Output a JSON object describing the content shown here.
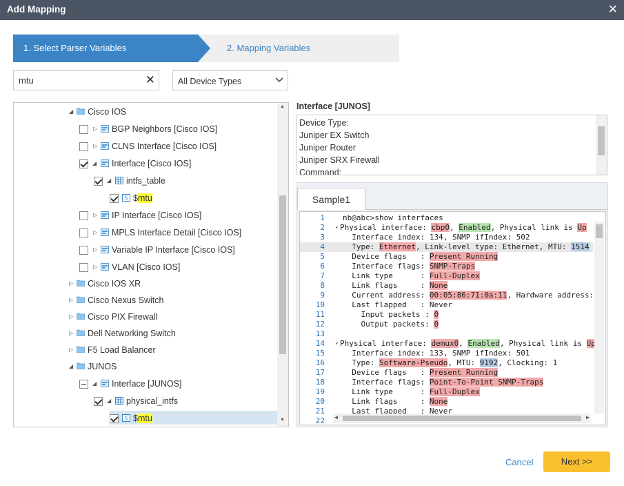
{
  "dialog": {
    "title": "Add Mapping"
  },
  "steps": {
    "step1": "1. Select Parser Variables",
    "step2": "2. Mapping Variables"
  },
  "search": {
    "value": "mtu"
  },
  "device_type": {
    "selected": "All Device Types"
  },
  "tree": {
    "cisco_ios": "Cisco IOS",
    "bgp": "BGP Neighbors [Cisco IOS]",
    "clns": "CLNS Interface [Cisco IOS]",
    "interface_ios": "Interface [Cisco IOS]",
    "intfs_table": "intfs_table",
    "var_prefix": "$",
    "var_name": "mtu",
    "ip_interface": "IP Interface [Cisco IOS]",
    "mpls": "MPLS Interface Detail [Cisco IOS]",
    "variable_ip": "Variable IP Interface [Cisco IOS]",
    "vlan": "VLAN [Cisco IOS]",
    "cisco_ios_xr": "Cisco IOS XR",
    "cisco_nexus": "Cisco Nexus Switch",
    "cisco_pix": "Cisco PIX Firewall",
    "dell": "Dell Networking Switch",
    "f5": "F5 Load Balancer",
    "junos": "JUNOS",
    "interface_junos": "Interface [JUNOS]",
    "physical_intfs": "physical_intfs"
  },
  "right": {
    "title": "Interface [JUNOS]",
    "device_type_lines": [
      "Device Type:",
      "Juniper EX Switch",
      "Juniper Router",
      "Juniper SRX Firewall",
      "Command:"
    ],
    "tab": "Sample1"
  },
  "code": {
    "n1": "1",
    "l1": "nb@abc>show interfaces",
    "n2": "2",
    "l2a": "Physical interface: ",
    "l2b": "cbp0",
    "l2c": ", ",
    "l2d": "Enabled",
    "l2e": ", Physical link is ",
    "l2f": "Up",
    "n3": "3",
    "l3": "  Interface index: 134, SNMP ifIndex: 502",
    "n4": "4",
    "l4a": "  Type: ",
    "l4b": "Ethernet",
    "l4c": ", Link-level type: Ethernet, MTU: ",
    "l4d": "1514",
    "n5": "5",
    "l5a": "  Device flags   : ",
    "l5b": "Present Running",
    "n6": "6",
    "l6a": "  Interface flags: ",
    "l6b": "SNMP-Traps",
    "n7": "7",
    "l7a": "  Link type      : ",
    "l7b": "Full-Duplex",
    "n8": "8",
    "l8a": "  Link flags     : ",
    "l8b": "None",
    "n9": "9",
    "l9a": "  Current address: ",
    "l9b": "00:05:86:71:0a:11",
    "l9c": ", Hardware address:",
    "n10": "10",
    "l10": "  Last flapped   : Never",
    "n11": "11",
    "l11a": "    Input packets : ",
    "l11b": "0",
    "n12": "12",
    "l12a": "    Output packets: ",
    "l12b": "0",
    "n13": "13",
    "n14": "14",
    "l14a": "Physical interface: ",
    "l14b": "demux0",
    "l14c": ", ",
    "l14d": "Enabled",
    "l14e": ", Physical link is ",
    "l14f": "Up",
    "n15": "15",
    "l15": "  Interface index: 133, SNMP ifIndex: 501",
    "n16": "16",
    "l16a": "  Type: ",
    "l16b": "Software-Pseudo",
    "l16c": ", MTU: ",
    "l16d": "9192",
    "l16e": ", Clocking: 1",
    "n17": "17",
    "l17a": "  Device flags   : ",
    "l17b": "Present Running",
    "n18": "18",
    "l18a": "  Interface flags: ",
    "l18b": "Point-To-Point SNMP-Traps",
    "n19": "19",
    "l19a": "  Link type      : ",
    "l19b": "Full-Duplex",
    "n20": "20",
    "l20a": "  Link flags     : ",
    "l20b": "None",
    "n21": "21",
    "l21": "  Last flapped   : Never",
    "n22": "22"
  },
  "buttons": {
    "cancel": "Cancel",
    "next": "Next >>"
  }
}
